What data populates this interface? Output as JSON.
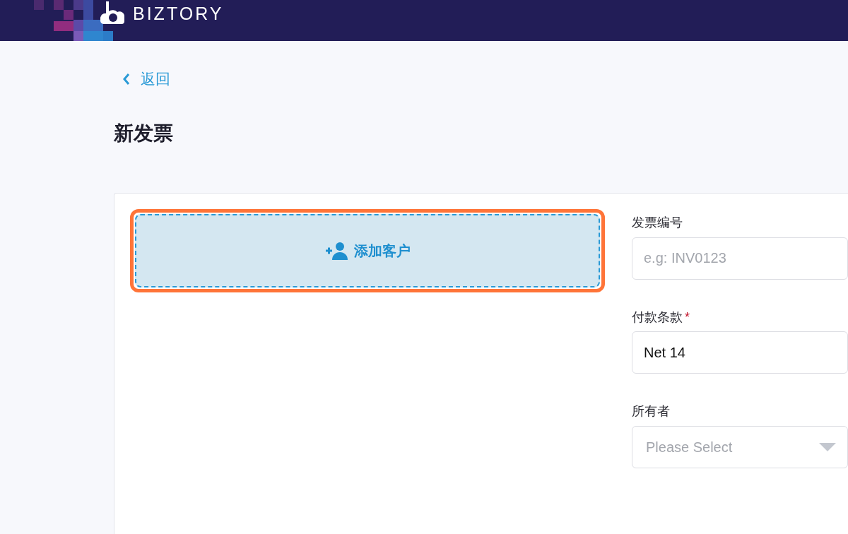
{
  "header": {
    "brand": "BIZTORY"
  },
  "back_link": {
    "label": "返回"
  },
  "page_title": "新发票",
  "add_customer": {
    "label": "添加客户",
    "highlighted": true
  },
  "fields": [
    {
      "kind": "text",
      "label": "发票编号",
      "placeholder": "e.g: INV0123"
    },
    {
      "kind": "text",
      "label": "付款条款",
      "required_mark": "*",
      "value": "Net 14"
    },
    {
      "kind": "select",
      "label": "所有者",
      "placeholder": "Please Select"
    }
  ]
}
